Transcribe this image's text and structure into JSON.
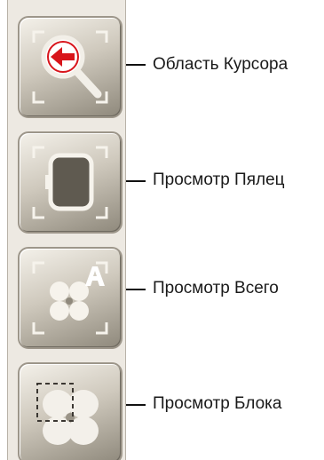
{
  "items": [
    {
      "label": "Область Курсора",
      "icon": "zoom-cursor-icon"
    },
    {
      "label": "Просмотр Пялец",
      "icon": "hoop-view-icon"
    },
    {
      "label": "Просмотр Всего",
      "icon": "view-all-icon"
    },
    {
      "label": "Просмотр Блока",
      "icon": "block-view-icon"
    }
  ],
  "colors": {
    "accent_red": "#d8151b",
    "button_light": "#f4f1ea",
    "button_dark": "#8f897c"
  }
}
